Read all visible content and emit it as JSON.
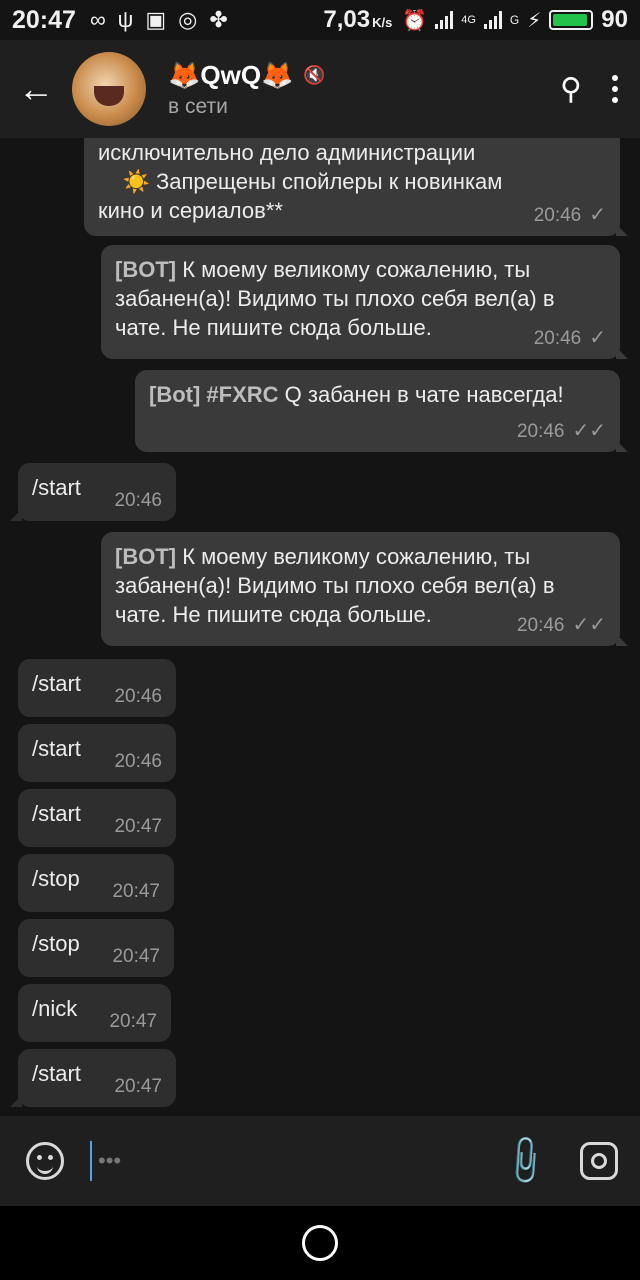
{
  "status_bar": {
    "time": "20:47",
    "icons_left": [
      "∞",
      "ψ",
      "▣",
      "◎",
      "✤"
    ],
    "speed": "7,03",
    "speed_unit": "K/s",
    "net_label_1": "4G",
    "net_label_2": "G",
    "battery": "90"
  },
  "header": {
    "title": "🦊QwQ🦊",
    "status": "в сети",
    "back_icon": "←",
    "search_icon": "⚲",
    "mute_icon": "🔇"
  },
  "messages": [
    {
      "dir": "out",
      "lines": [
        "исключительно дело администрации",
        "    ☀️ Запрещены спойлеры к новинкам",
        "кино и сериалов**"
      ],
      "time": "20:46",
      "check": "✓"
    },
    {
      "dir": "out",
      "prefix": "[BOT]",
      "text": " К моему великому сожалению, ты забанен(а)! Видимо ты плохо себя вел(а) в чате. Не пишите сюда больше.",
      "time": "20:46",
      "check": "✓"
    },
    {
      "dir": "out",
      "prefix": "[Bot] #FXRC",
      "text": " Q забанен в чате навсегда!",
      "time": "20:46",
      "check": "✓✓"
    },
    {
      "dir": "in",
      "text": "/start",
      "time": "20:46"
    },
    {
      "dir": "out",
      "prefix": "[BOT]",
      "text": " К моему великому сожалению, ты забанен(а)! Видимо ты плохо себя вел(а) в чате. Не пишите сюда больше.",
      "time": "20:46",
      "check": "✓✓"
    },
    {
      "dir": "in",
      "text": "/start",
      "time": "20:46"
    },
    {
      "dir": "in",
      "text": "/start",
      "time": "20:46"
    },
    {
      "dir": "in",
      "text": "/start",
      "time": "20:47"
    },
    {
      "dir": "in",
      "text": "/stop",
      "time": "20:47"
    },
    {
      "dir": "in",
      "text": "/stop",
      "time": "20:47"
    },
    {
      "dir": "in",
      "text": "/nick",
      "time": "20:47"
    },
    {
      "dir": "in",
      "text": "/start",
      "time": "20:47"
    }
  ],
  "composer": {
    "placeholder": "•••"
  }
}
